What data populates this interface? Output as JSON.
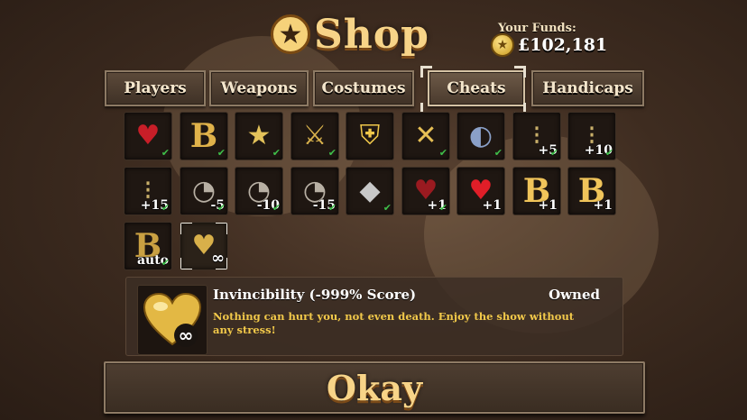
{
  "header": {
    "title": "Shop",
    "title_icon": "star-icon",
    "funds_label": "Your Funds:",
    "funds_value": "£102,181",
    "funds_icon": "coin-icon"
  },
  "tabs": [
    {
      "label": "Players",
      "active": false
    },
    {
      "label": "Weapons",
      "active": false
    },
    {
      "label": "Costumes",
      "active": false
    },
    {
      "label": "Cheats",
      "active": true
    },
    {
      "label": "Handicaps",
      "active": false
    }
  ],
  "items": [
    {
      "icon": "heart-icon",
      "glyph": "♥",
      "color": "#c81e28",
      "overlay": "",
      "owned": true
    },
    {
      "icon": "bomb-letter-icon",
      "glyph": "B",
      "color": "#e0b24a",
      "overlay": "",
      "owned": true
    },
    {
      "icon": "star-icon",
      "glyph": "★",
      "color": "#e3c25a",
      "overlay": "",
      "owned": true
    },
    {
      "icon": "crossed-swords-icon",
      "glyph": "⚔",
      "color": "#d8b14c",
      "overlay": "",
      "owned": true
    },
    {
      "icon": "shield-icon",
      "glyph": "⛨",
      "color": "#f1c84a",
      "overlay": "",
      "owned": false
    },
    {
      "icon": "broken-shield-icon",
      "glyph": "✕",
      "color": "#e7c055",
      "overlay": "",
      "owned": true
    },
    {
      "icon": "magnet-icon",
      "glyph": "◐",
      "color": "#8aa0c8",
      "overlay": "",
      "owned": true
    },
    {
      "icon": "bullets-icon",
      "glyph": "⁝",
      "color": "#c9b06a",
      "overlay": "+5",
      "owned": true
    },
    {
      "icon": "bullets-icon",
      "glyph": "⁝",
      "color": "#c9b06a",
      "overlay": "+10",
      "owned": true
    },
    {
      "icon": "bullets-icon",
      "glyph": "⁝",
      "color": "#c9b06a",
      "overlay": "+15",
      "owned": true
    },
    {
      "icon": "speedometer-icon",
      "glyph": "◔",
      "color": "#b8b0a4",
      "overlay": "-5",
      "owned": true
    },
    {
      "icon": "speedometer-icon",
      "glyph": "◔",
      "color": "#b8b0a4",
      "overlay": "-10",
      "owned": true
    },
    {
      "icon": "speedometer-icon",
      "glyph": "◔",
      "color": "#b8b0a4",
      "overlay": "-15",
      "owned": true
    },
    {
      "icon": "diamond-icon",
      "glyph": "◆",
      "color": "#c8c8c8",
      "overlay": "",
      "owned": true
    },
    {
      "icon": "heart-icon",
      "glyph": "♥",
      "color": "#9a1a20",
      "overlay": "+1",
      "owned": true
    },
    {
      "icon": "heart-icon",
      "glyph": "♥",
      "color": "#e01e28",
      "overlay": "+1",
      "owned": false
    },
    {
      "icon": "bomb-letter-icon",
      "glyph": "B",
      "color": "#f0c45a",
      "overlay": "+1",
      "owned": false
    },
    {
      "icon": "bomb-letter-icon",
      "glyph": "B",
      "color": "#f0c45a",
      "overlay": "+1",
      "owned": false
    },
    {
      "icon": "bomb-letter-icon",
      "glyph": "B",
      "color": "#c9a042",
      "overlay": "auto",
      "owned": true
    },
    {
      "icon": "golden-heart-infinity-icon",
      "glyph": "♥",
      "color": "#d8b04a",
      "overlay": "∞",
      "owned": false,
      "selected": true
    }
  ],
  "selected": {
    "name": "Invincibility (-999% Score)",
    "status": "Owned",
    "description": "Nothing can hurt you, not even death. Enjoy the show without any stress!",
    "icon": "golden-heart-infinity-icon"
  },
  "okay_label": "Okay"
}
